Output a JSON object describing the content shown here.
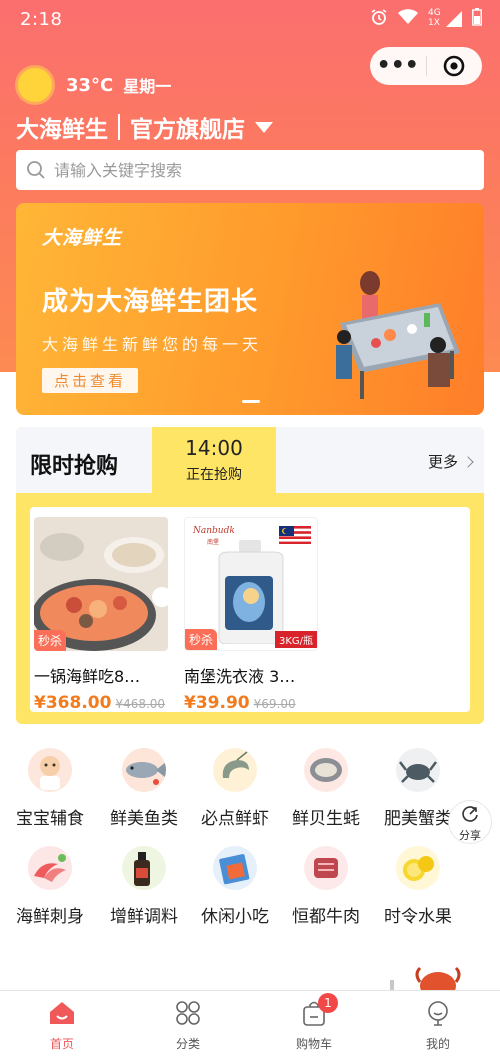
{
  "status_bar": {
    "time": "2:18",
    "network": "4G",
    "network_sub": "1X"
  },
  "colors": {
    "brand": "#fb6f6f",
    "banner": "#ff9a2c",
    "flash_bg": "#ffe566",
    "price": "#f37b1d",
    "tab_active": "#f0585a"
  },
  "header": {
    "temperature": "33°C",
    "weekday": "星期一",
    "store_name": "大海鲜生",
    "store_type": "官方旗舰店"
  },
  "search": {
    "placeholder": "请输入关键字搜索"
  },
  "banner": {
    "logo": "大海鲜生",
    "headline": "成为大海鲜生团长",
    "subline": "大海鲜生新鲜您的每一天",
    "cta": "点击查看"
  },
  "flash_sale": {
    "title": "限时抢购",
    "time": "14:00",
    "status": "正在抢购",
    "more": "更多",
    "products": [
      {
        "tag": "秒杀",
        "name": "一锅海鲜吃8…",
        "price": "¥368.00",
        "original": "¥468.00"
      },
      {
        "tag": "秒杀",
        "name": "南堡洗衣液 3…",
        "price": "¥39.90",
        "original": "¥69.00",
        "brand": "Nanbudk",
        "brand_sub": "南堡",
        "pack_label": "3KG/瓶"
      }
    ]
  },
  "categories": [
    {
      "label": "宝宝辅食",
      "icon": "baby-food-icon"
    },
    {
      "label": "鲜美鱼类",
      "icon": "fish-icon"
    },
    {
      "label": "必点鲜虾",
      "icon": "shrimp-icon"
    },
    {
      "label": "鲜贝生蚝",
      "icon": "oyster-icon"
    },
    {
      "label": "肥美蟹类",
      "icon": "crab-icon"
    },
    {
      "label": "海鲜刺身",
      "icon": "sashimi-icon"
    },
    {
      "label": "增鲜调料",
      "icon": "seasoning-icon"
    },
    {
      "label": "休闲小吃",
      "icon": "snack-icon"
    },
    {
      "label": "恒都牛肉",
      "icon": "beef-icon"
    },
    {
      "label": "时令水果",
      "icon": "fruit-icon"
    }
  ],
  "share": {
    "label": "分享"
  },
  "tabbar": {
    "items": [
      {
        "label": "首页",
        "icon": "home-icon"
      },
      {
        "label": "分类",
        "icon": "category-icon"
      },
      {
        "label": "购物车",
        "icon": "cart-icon",
        "badge": "1"
      },
      {
        "label": "我的",
        "icon": "profile-icon"
      }
    ]
  }
}
